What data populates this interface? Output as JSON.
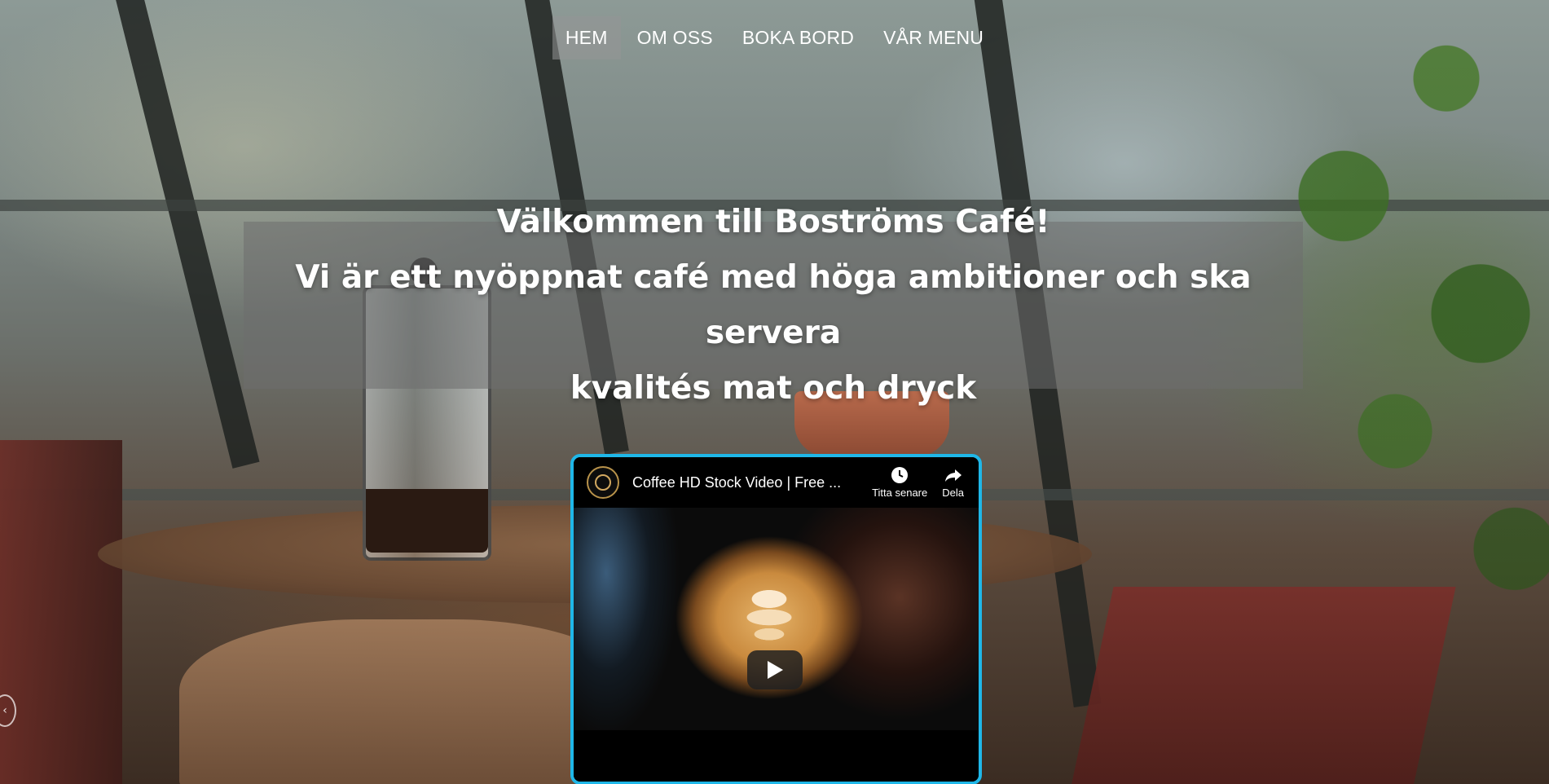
{
  "nav": {
    "items": [
      {
        "label": "HEM",
        "active": true
      },
      {
        "label": "OM OSS",
        "active": false
      },
      {
        "label": "BOKA BORD",
        "active": false
      },
      {
        "label": "VÅR MENU",
        "active": false
      }
    ]
  },
  "hero": {
    "line1": "Välkommen till Boströms Café!",
    "line2": "Vi är ett nyöppnat café med höga ambitioner och ska servera",
    "line3": "kvalités mat och dryck"
  },
  "video": {
    "title": "Coffee HD Stock Video | Free ...",
    "watch_later_label": "Titta senare",
    "share_label": "Dela",
    "icons": {
      "watch_later": "clock-icon",
      "share": "share-arrow-icon",
      "play": "play-icon",
      "channel": "channel-logo"
    },
    "border_color": "#1fb7e8"
  },
  "carousel": {
    "prev_icon": "chevron-left-icon"
  }
}
